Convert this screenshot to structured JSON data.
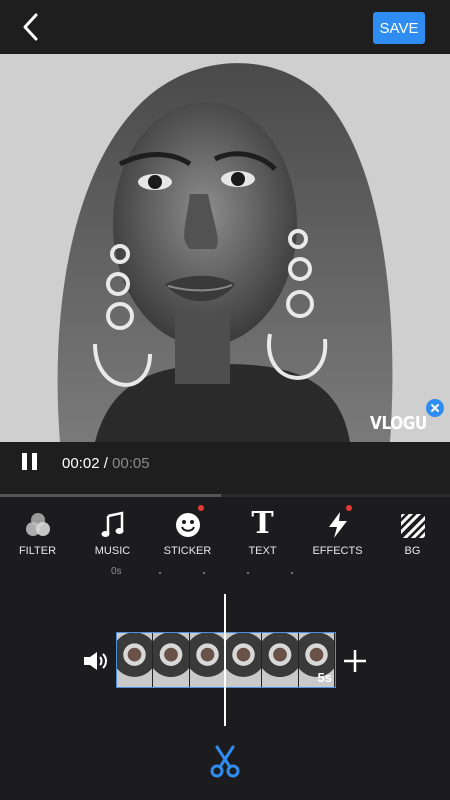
{
  "header": {
    "save_label": "SAVE"
  },
  "preview": {
    "watermark": "VLOGU"
  },
  "playback": {
    "current_time": "00:02",
    "separator": " / ",
    "total_time": "00:05",
    "progress": 0.49
  },
  "tools": [
    {
      "label": "FILTER",
      "icon": "filter-icon",
      "badge": false
    },
    {
      "label": "MUSIC",
      "icon": "music-note-icon",
      "badge": false
    },
    {
      "label": "STICKER",
      "icon": "smiley-sticker-icon",
      "badge": true
    },
    {
      "label": "TEXT",
      "icon": "text-icon",
      "badge": false
    },
    {
      "label": "EFFECTS",
      "icon": "lightning-effects-icon",
      "badge": true
    },
    {
      "label": "BG",
      "icon": "stripes-background-icon",
      "badge": false
    }
  ],
  "timeline": {
    "start_label": "0s",
    "clip_duration": "5s",
    "frames": 6
  },
  "colors": {
    "accent": "#2f8cf0",
    "badge": "#e53935",
    "background": "#1c1c1e"
  }
}
